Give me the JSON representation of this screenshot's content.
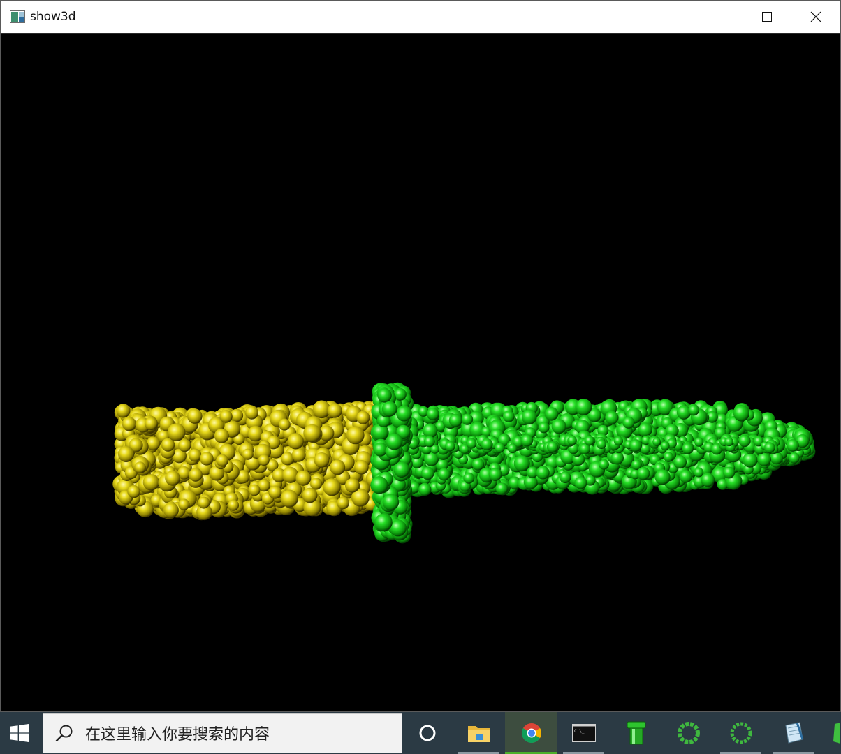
{
  "window": {
    "title": "show3d",
    "minimize_glyph": "—",
    "maximize_glyph": "☐",
    "close_glyph": "✕"
  },
  "scene": {
    "background": "#000000",
    "handle_color": "#d4c400",
    "blade_color": "#1fd41f",
    "guard_color": "#1fd41f"
  },
  "taskbar": {
    "search_placeholder": "在这里输入你要搜索的内容",
    "items": [
      {
        "name": "cortana-icon"
      },
      {
        "name": "file-explorer-icon"
      },
      {
        "name": "chrome-icon",
        "active": true
      },
      {
        "name": "command-prompt-icon"
      },
      {
        "name": "green-pipe-app-icon"
      },
      {
        "name": "loading-ring-app-icon"
      },
      {
        "name": "loading-ring-app-icon-2"
      },
      {
        "name": "notepad-app-icon"
      },
      {
        "name": "green-app-icon"
      }
    ]
  }
}
